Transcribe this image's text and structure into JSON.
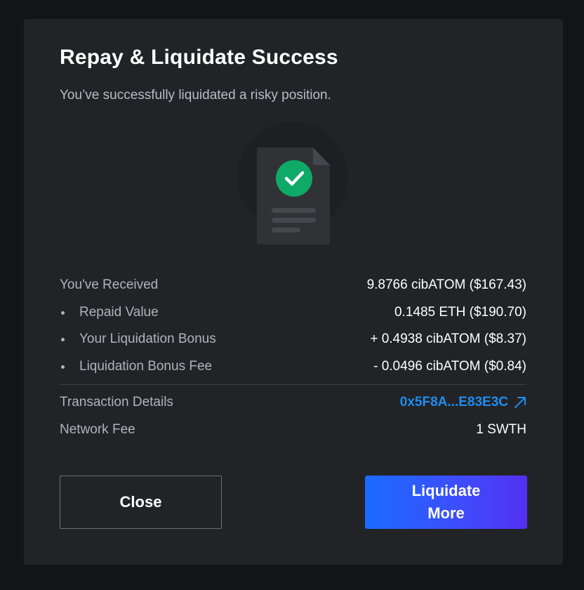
{
  "modal": {
    "title": "Repay & Liquidate Success",
    "subtitle": "You’ve successfully liquidated a risky position."
  },
  "summary": {
    "received": {
      "label": "You've Received",
      "value": "9.8766 cibATOM ($167.43)"
    },
    "items": [
      {
        "label": "Repaid Value",
        "value": "0.1485 ETH ($190.70)"
      },
      {
        "label": "Your Liquidation Bonus",
        "value": "+ 0.4938 cibATOM ($8.37)"
      },
      {
        "label": "Liquidation Bonus Fee",
        "value": "- 0.0496 cibATOM ($0.84)"
      }
    ],
    "transaction": {
      "label": "Transaction Details",
      "value": "0x5F8A...E83E3C"
    },
    "network_fee": {
      "label": "Network Fee",
      "value": "1 SWTH"
    }
  },
  "actions": {
    "close_label": "Close",
    "liquidate_more_label": "Liquidate More"
  },
  "colors": {
    "background": "#131416",
    "modal": "#222326",
    "accent_link": "#1c8ff0",
    "success": "#0fa968",
    "button_gradient_start": "#1a6bff",
    "button_gradient_end": "#5330f2"
  },
  "icons": {
    "illustration": "document-success-icon",
    "check": "checkmark-icon",
    "external_link": "arrow-up-right-icon"
  }
}
